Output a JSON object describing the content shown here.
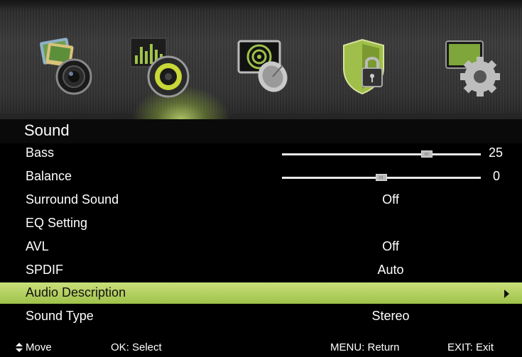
{
  "menu_tabs": [
    {
      "name": "Picture",
      "icon": "picture-camera-icon"
    },
    {
      "name": "Sound",
      "icon": "speaker-icon",
      "active": true
    },
    {
      "name": "Channel",
      "icon": "satellite-dish-icon"
    },
    {
      "name": "Lock",
      "icon": "shield-lock-icon"
    },
    {
      "name": "Setup",
      "icon": "gear-icon"
    }
  ],
  "section_title": "Sound",
  "items": [
    {
      "label": "Bass",
      "value": "25",
      "slider_fraction": 0.73
    },
    {
      "label": "Balance",
      "value": "0",
      "slider_fraction": 0.5
    },
    {
      "label": "Surround Sound",
      "value": "Off"
    },
    {
      "label": "EQ Setting",
      "value": ""
    },
    {
      "label": "AVL",
      "value": "Off"
    },
    {
      "label": "SPDIF",
      "value": "Auto"
    },
    {
      "label": "Audio Description",
      "value": "",
      "selected": true
    },
    {
      "label": "Sound Type",
      "value": "Stereo"
    }
  ],
  "footer": {
    "move": "Move",
    "select": "OK: Select",
    "return": "MENU: Return",
    "exit": "EXIT: Exit"
  },
  "colors": {
    "highlight": "#b5d460",
    "background": "#000000",
    "text": "#ffffff"
  }
}
